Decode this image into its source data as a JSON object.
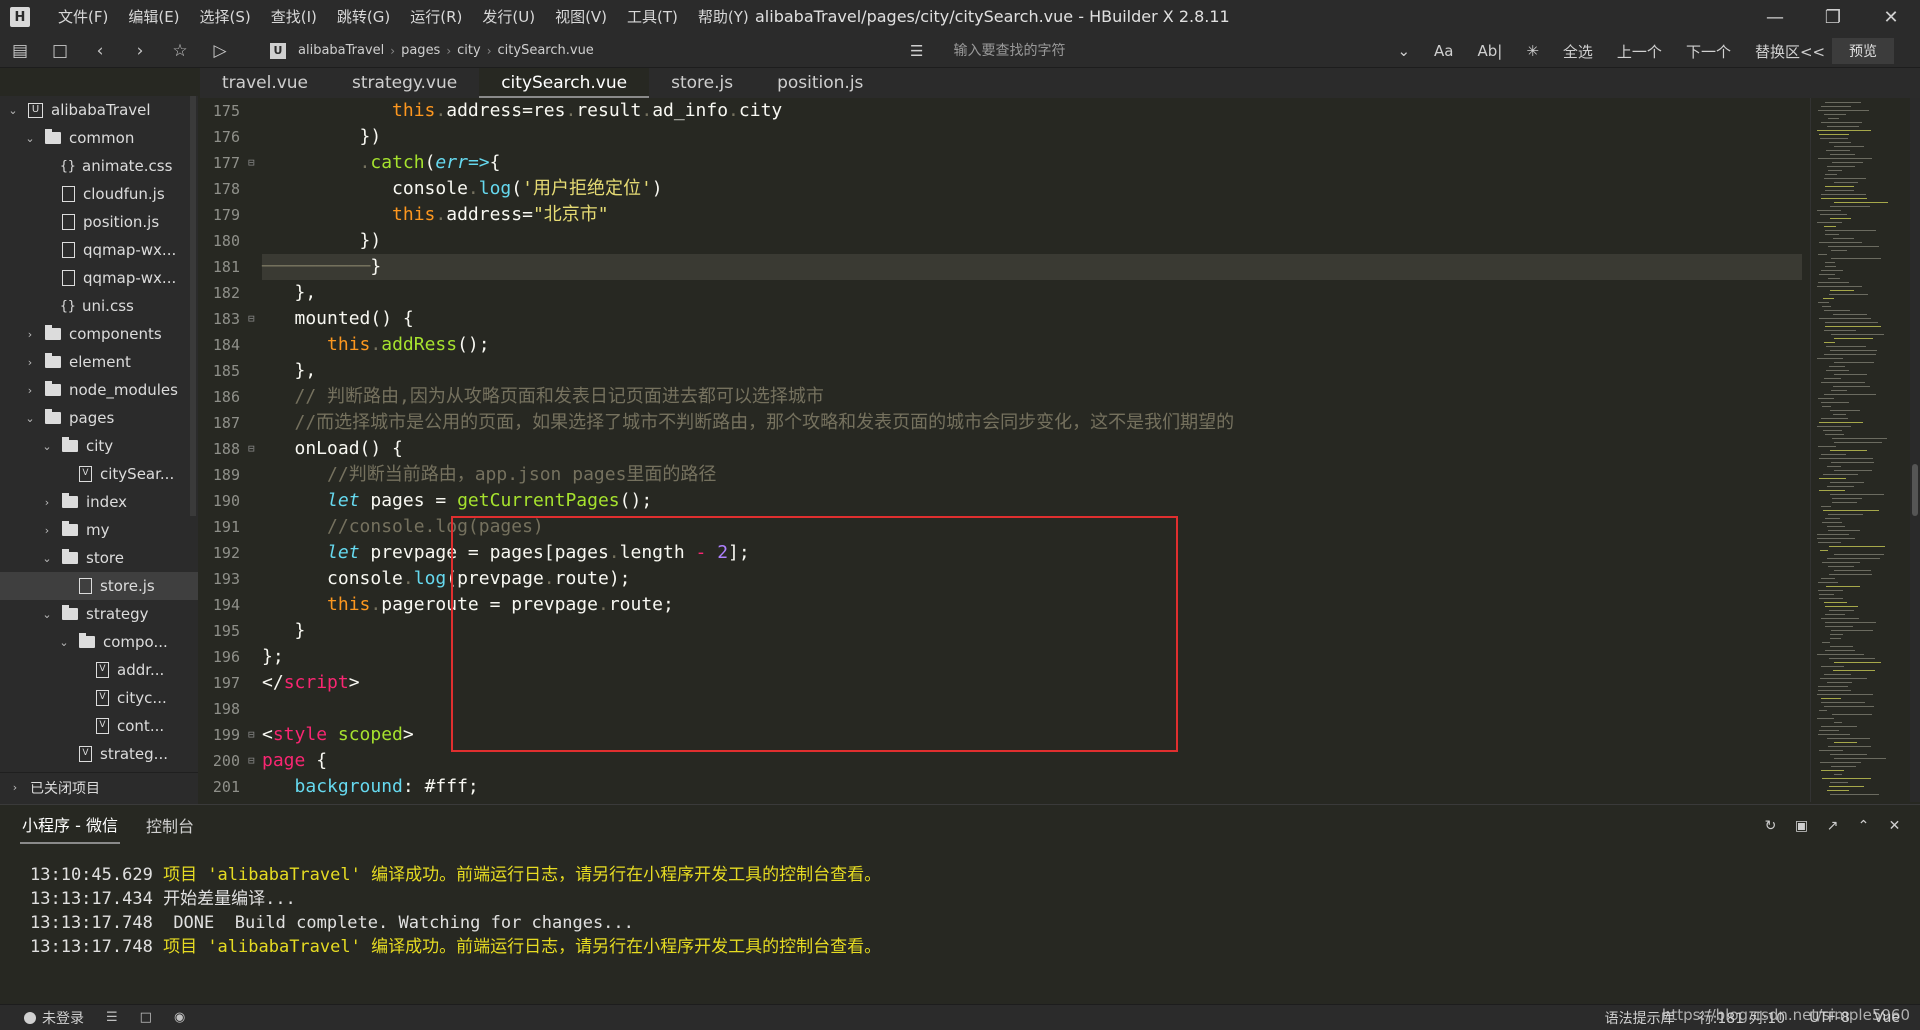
{
  "titlebar": {
    "logo": "H",
    "menus": [
      "文件(F)",
      "编辑(E)",
      "选择(S)",
      "查找(I)",
      "跳转(G)",
      "运行(R)",
      "发行(U)",
      "视图(V)",
      "工具(T)",
      "帮助(Y)"
    ],
    "window_title": "alibabaTravel/pages/city/citySearch.vue - HBuilder X 2.8.11",
    "controls": [
      "minimize-icon",
      "maximize-icon",
      "close-icon"
    ]
  },
  "toolbar": {
    "breadcrumb": [
      "alibabaTravel",
      "pages",
      "city",
      "citySearch.vue"
    ],
    "search_placeholder": "输入要查找的字符",
    "find_options": [
      "Aa",
      "Ab|"
    ],
    "find_buttons": [
      "全选",
      "上一个",
      "下一个",
      "替换区<<"
    ],
    "preview_label": "预览"
  },
  "sidebar": {
    "items": [
      {
        "label": "alibabaTravel",
        "type": "project",
        "level": 0,
        "expanded": true
      },
      {
        "label": "common",
        "type": "folder",
        "level": 1,
        "expanded": true
      },
      {
        "label": "animate.css",
        "type": "brace",
        "level": 2
      },
      {
        "label": "cloudfun.js",
        "type": "file",
        "level": 2
      },
      {
        "label": "position.js",
        "type": "file",
        "level": 2
      },
      {
        "label": "qqmap-wx...",
        "type": "file",
        "level": 2
      },
      {
        "label": "qqmap-wx...",
        "type": "file",
        "level": 2
      },
      {
        "label": "uni.css",
        "type": "brace",
        "level": 2
      },
      {
        "label": "components",
        "type": "folder",
        "level": 1,
        "expanded": false
      },
      {
        "label": "element",
        "type": "folder",
        "level": 1,
        "expanded": false
      },
      {
        "label": "node_modules",
        "type": "folder",
        "level": 1,
        "expanded": false
      },
      {
        "label": "pages",
        "type": "folder",
        "level": 1,
        "expanded": true
      },
      {
        "label": "city",
        "type": "folder",
        "level": 2,
        "expanded": true
      },
      {
        "label": "citySear...",
        "type": "vfile",
        "level": 3
      },
      {
        "label": "index",
        "type": "folder",
        "level": 2,
        "expanded": false
      },
      {
        "label": "my",
        "type": "folder",
        "level": 2,
        "expanded": false
      },
      {
        "label": "store",
        "type": "folder",
        "level": 2,
        "expanded": true
      },
      {
        "label": "store.js",
        "type": "file",
        "level": 3,
        "selected": true
      },
      {
        "label": "strategy",
        "type": "folder",
        "level": 2,
        "expanded": true
      },
      {
        "label": "compo...",
        "type": "folder",
        "level": 3,
        "expanded": true
      },
      {
        "label": "addr...",
        "type": "vfile",
        "level": 4
      },
      {
        "label": "cityc...",
        "type": "vfile",
        "level": 4
      },
      {
        "label": "cont...",
        "type": "vfile",
        "level": 4
      },
      {
        "label": "strateg...",
        "type": "vfile",
        "level": 3
      }
    ],
    "closed_projects": "已关闭项目"
  },
  "tabs": [
    {
      "label": "travel.vue",
      "active": false
    },
    {
      "label": "strategy.vue",
      "active": false
    },
    {
      "label": "citySearch.vue",
      "active": true
    },
    {
      "label": "store.js",
      "active": false
    },
    {
      "label": "position.js",
      "active": false
    }
  ],
  "editor": {
    "current_line": 181,
    "lines": [
      {
        "n": "175",
        "fold": false,
        "tokens": [
          [
            "",
            "            "
          ],
          [
            "t-this",
            "this"
          ],
          [
            "t-dim",
            "."
          ],
          [
            "",
            "address=res"
          ],
          [
            "t-dim",
            "."
          ],
          [
            "",
            "result"
          ],
          [
            "t-dim",
            "."
          ],
          [
            "",
            "ad_info"
          ],
          [
            "t-dim",
            "."
          ],
          [
            "",
            "city"
          ]
        ]
      },
      {
        "n": "176",
        "fold": false,
        "tokens": [
          [
            "",
            "         })"
          ]
        ]
      },
      {
        "n": "177",
        "fold": true,
        "tokens": [
          [
            "",
            "         "
          ],
          [
            "t-dim",
            "."
          ],
          [
            "t-fn",
            "catch"
          ],
          [
            "",
            "("
          ],
          [
            "t-kw",
            "err"
          ],
          [
            "t-prop",
            "=>"
          ],
          [
            "",
            "{"
          ]
        ]
      },
      {
        "n": "178",
        "fold": false,
        "tokens": [
          [
            "",
            "            console"
          ],
          [
            "t-dim",
            "."
          ],
          [
            "t-prop",
            "log"
          ],
          [
            "",
            "("
          ],
          [
            "t-str",
            "'用户拒绝定位'"
          ],
          [
            "",
            ")"
          ]
        ]
      },
      {
        "n": "179",
        "fold": false,
        "tokens": [
          [
            "",
            "            "
          ],
          [
            "t-this",
            "this"
          ],
          [
            "t-dim",
            "."
          ],
          [
            "",
            "address="
          ],
          [
            "t-str",
            "\"北京市\""
          ]
        ]
      },
      {
        "n": "180",
        "fold": false,
        "tokens": [
          [
            "",
            "         })"
          ]
        ]
      },
      {
        "n": "181",
        "fold": false,
        "tokens": [
          [
            "t-dim",
            "──────────"
          ],
          [
            "",
            "}"
          ]
        ]
      },
      {
        "n": "182",
        "fold": false,
        "tokens": [
          [
            "",
            "   },"
          ]
        ]
      },
      {
        "n": "183",
        "fold": true,
        "tokens": [
          [
            "",
            "   mounted() {"
          ]
        ]
      },
      {
        "n": "184",
        "fold": false,
        "tokens": [
          [
            "",
            "      "
          ],
          [
            "t-this",
            "this"
          ],
          [
            "t-dim",
            "."
          ],
          [
            "t-fn",
            "addRess"
          ],
          [
            "",
            "();"
          ]
        ]
      },
      {
        "n": "185",
        "fold": false,
        "tokens": [
          [
            "",
            "   },"
          ]
        ]
      },
      {
        "n": "186",
        "fold": false,
        "tokens": [
          [
            "t-cmt",
            "   // 判断路由,因为从攻略页面和发表日记页面进去都可以选择城市"
          ]
        ]
      },
      {
        "n": "187",
        "fold": false,
        "tokens": [
          [
            "t-cmt",
            "   //而选择城市是公用的页面，如果选择了城市不判断路由，那个攻略和发表页面的城市会同步变化，这不是我们期望的"
          ]
        ]
      },
      {
        "n": "188",
        "fold": true,
        "tokens": [
          [
            "",
            "   onLoad() {"
          ]
        ]
      },
      {
        "n": "189",
        "fold": false,
        "tokens": [
          [
            "t-cmt",
            "      //判断当前路由，app.json pages里面的路径"
          ]
        ]
      },
      {
        "n": "190",
        "fold": false,
        "tokens": [
          [
            "",
            "      "
          ],
          [
            "t-kw",
            "let"
          ],
          [
            "",
            " pages = "
          ],
          [
            "t-fn",
            "getCurrentPages"
          ],
          [
            "",
            "();"
          ]
        ]
      },
      {
        "n": "191",
        "fold": false,
        "tokens": [
          [
            "t-cmt",
            "      //console.log(pages)"
          ]
        ]
      },
      {
        "n": "192",
        "fold": false,
        "tokens": [
          [
            "",
            "      "
          ],
          [
            "t-kw",
            "let"
          ],
          [
            "",
            " prevpage = pages[pages"
          ],
          [
            "t-dim",
            "."
          ],
          [
            "",
            "length "
          ],
          [
            "t-op",
            "-"
          ],
          [
            "",
            " "
          ],
          [
            "t-num",
            "2"
          ],
          [
            "",
            "];"
          ]
        ]
      },
      {
        "n": "193",
        "fold": false,
        "tokens": [
          [
            "",
            "      console"
          ],
          [
            "t-dim",
            "."
          ],
          [
            "t-prop",
            "log"
          ],
          [
            "",
            "(prevpage"
          ],
          [
            "t-dim",
            "."
          ],
          [
            "",
            "route);"
          ]
        ]
      },
      {
        "n": "194",
        "fold": false,
        "tokens": [
          [
            "",
            "      "
          ],
          [
            "t-this",
            "this"
          ],
          [
            "t-dim",
            "."
          ],
          [
            "",
            "pageroute = prevpage"
          ],
          [
            "t-dim",
            "."
          ],
          [
            "",
            "route;"
          ]
        ]
      },
      {
        "n": "195",
        "fold": false,
        "tokens": [
          [
            "",
            "   }"
          ]
        ]
      },
      {
        "n": "196",
        "fold": false,
        "tokens": [
          [
            "",
            "};"
          ]
        ]
      },
      {
        "n": "197",
        "fold": false,
        "tokens": [
          [
            "",
            "</"
          ],
          [
            "t-tag",
            "script"
          ],
          [
            "",
            ">"
          ]
        ]
      },
      {
        "n": "198",
        "fold": false,
        "tokens": [
          [
            "",
            ""
          ]
        ]
      },
      {
        "n": "199",
        "fold": true,
        "tokens": [
          [
            "",
            "<"
          ],
          [
            "t-tag",
            "style"
          ],
          [
            "",
            " "
          ],
          [
            "t-attr",
            "scoped"
          ],
          [
            "",
            ">"
          ]
        ]
      },
      {
        "n": "200",
        "fold": true,
        "tokens": [
          [
            "t-tag",
            "page"
          ],
          [
            "",
            " {"
          ]
        ]
      },
      {
        "n": "201",
        "fold": false,
        "tokens": [
          [
            "",
            "   "
          ],
          [
            "t-prop",
            "background"
          ],
          [
            "",
            ": #fff;"
          ]
        ]
      }
    ]
  },
  "console": {
    "tabs": [
      {
        "label": "小程序 - 微信",
        "active": true
      },
      {
        "label": "控制台",
        "active": false
      }
    ],
    "tools": [
      "restart-icon",
      "stop-icon",
      "export-icon",
      "collapse-icon",
      "close-panel-icon"
    ],
    "log": [
      {
        "time": "13:10:45.629",
        "text": "项目 'alibabaTravel' 编译成功。前端运行日志，请另行在小程序开发工具的控制台查看。",
        "color": "yellow"
      },
      {
        "time": "13:13:17.434",
        "text": "开始差量编译...",
        "color": "white"
      },
      {
        "time": "13:13:17.748",
        "text": " DONE  Build complete. Watching for changes...",
        "color": "white"
      },
      {
        "time": "13:13:17.748",
        "text": "项目 'alibabaTravel' 编译成功。前端运行日志，请另行在小程序开发工具的控制台查看。",
        "color": "yellow"
      }
    ]
  },
  "statusbar": {
    "user": "未登录",
    "hint_lib": "语法提示库",
    "position": "行:181  列:10",
    "encoding": "UTF-8",
    "language": "Vue",
    "watermark": "https://blog.csdn.net/simple5960"
  },
  "colors": {
    "highlight_box": "#e02f2f",
    "editor_bg": "#272822",
    "log_yellow": "#e6db22"
  }
}
